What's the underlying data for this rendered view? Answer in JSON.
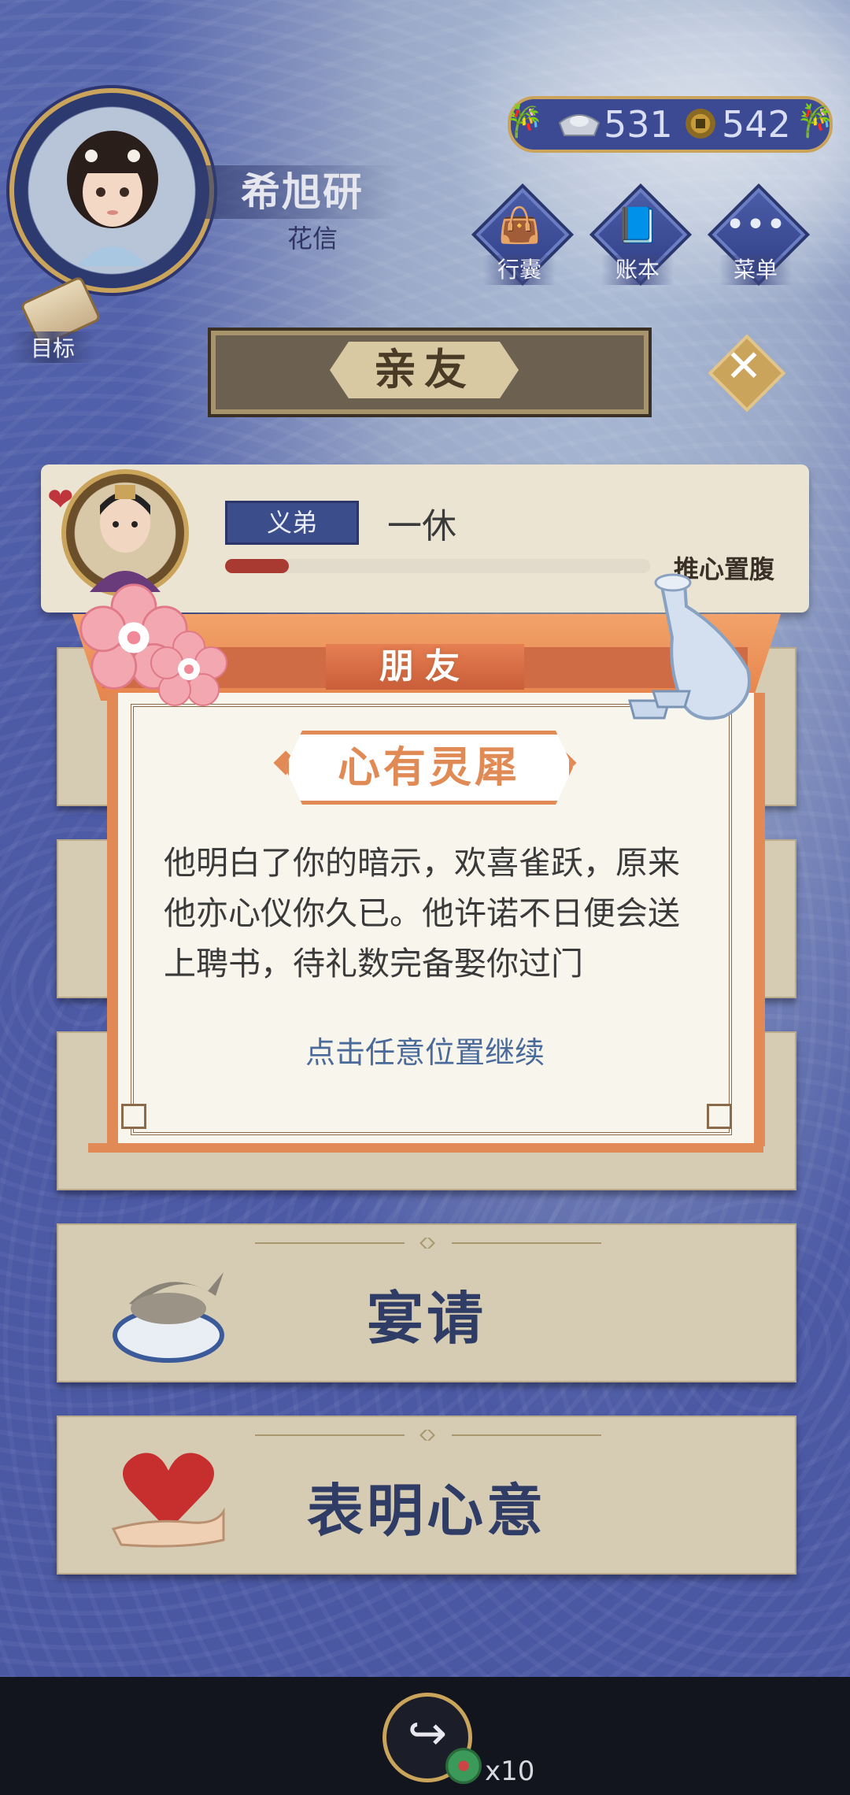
{
  "player": {
    "name": "希旭研",
    "subtitle": "花信"
  },
  "currency": {
    "silver": "531",
    "coins": "542"
  },
  "top_menu": [
    {
      "label": "行囊",
      "icon": "bag-icon"
    },
    {
      "label": "账本",
      "icon": "ledger-icon"
    },
    {
      "label": "菜单",
      "icon": "more-icon"
    }
  ],
  "goal_label": "目标",
  "page_title": "亲友",
  "friend": {
    "tag": "义弟",
    "name": "一休",
    "relation": "推心置腹",
    "affinity_fraction": 0.15
  },
  "actions": [
    {
      "label": "宴请",
      "icon": "fish-dish-icon"
    },
    {
      "label": "表明心意",
      "icon": "heart-hand-icon"
    }
  ],
  "modal": {
    "header": "朋友",
    "heading": "心有灵犀",
    "body": "他明白了你的暗示，欢喜雀跃，原来他亦心仪你久已。他许诺不日便会送上聘书，待礼数完备娶你过门",
    "hint": "点击任意位置继续"
  },
  "share": {
    "count": "x10"
  },
  "colors": {
    "accent_orange": "#e28a55",
    "navy": "#3b4d8a",
    "gold": "#c9a45a"
  }
}
